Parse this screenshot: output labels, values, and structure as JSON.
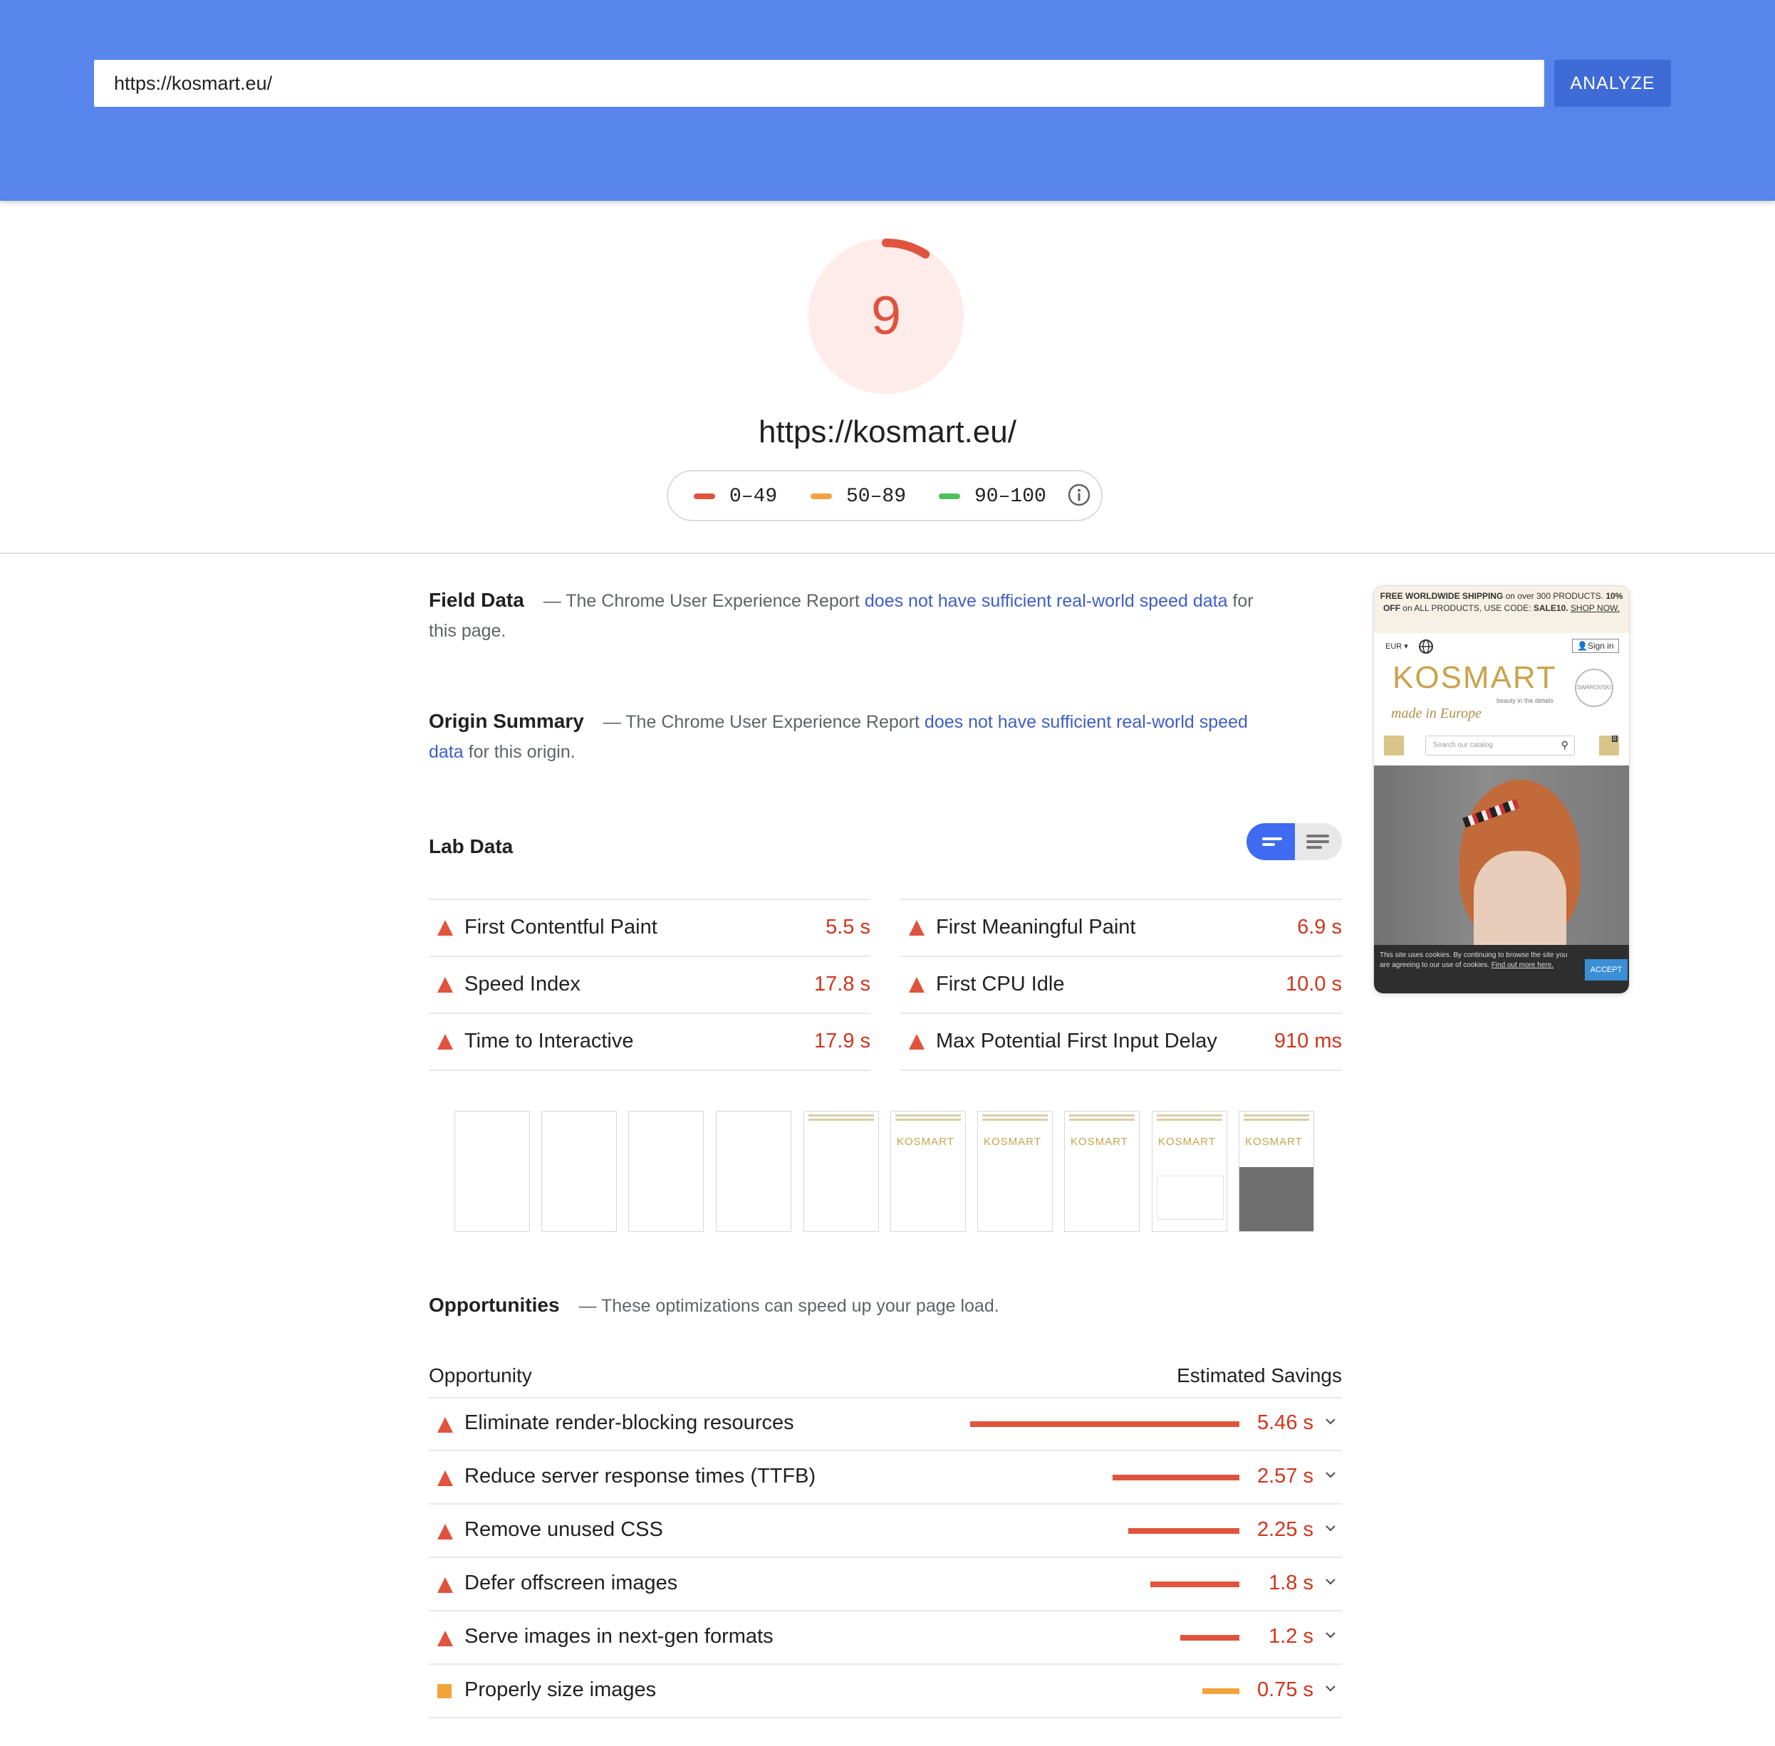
{
  "header": {
    "url_value": "https://kosmart.eu/",
    "analyze_label": "ANALYZE"
  },
  "score": {
    "value": "9",
    "fraction": 0.09,
    "color": "#e0543e",
    "bg_color": "#fdece9"
  },
  "page_url": "https://kosmart.eu/",
  "legend": {
    "ranges": [
      {
        "label": "0–49",
        "color": "#e0543e"
      },
      {
        "label": "50–89",
        "color": "#f2a33a"
      },
      {
        "label": "90–100",
        "color": "#4fc05a"
      }
    ],
    "info_icon": "info-icon"
  },
  "field_data": {
    "title": "Field Data",
    "prefix": "— The Chrome User Experience Report ",
    "link": "does not have sufficient real-world speed data",
    "suffix": " for this page."
  },
  "origin_summary": {
    "title": "Origin Summary",
    "prefix": "— The Chrome User Experience Report ",
    "link": "does not have sufficient real-world speed data",
    "suffix": " for this origin."
  },
  "lab_data": {
    "title": "Lab Data",
    "metrics_left": [
      {
        "name": "First Contentful Paint",
        "value": "5.5 s"
      },
      {
        "name": "Speed Index",
        "value": "17.8 s"
      },
      {
        "name": "Time to Interactive",
        "value": "17.9 s"
      }
    ],
    "metrics_right": [
      {
        "name": "First Meaningful Paint",
        "value": "6.9 s"
      },
      {
        "name": "First CPU Idle",
        "value": "10.0 s"
      },
      {
        "name": "Max Potential First Input Delay",
        "value": "910 ms"
      }
    ]
  },
  "thumbnail": {
    "banner_bold1": "FREE WORLDWIDE SHIPPING",
    "banner_text1": " on over 300 PRODUCTS. ",
    "banner_bold2": "10% OFF",
    "banner_text2": " on ALL PRODUCTS, USE CODE: ",
    "banner_bold3": "SALE10.",
    "banner_link": "SHOP NOW.",
    "currency": "EUR ▾",
    "sign_in": "Sign in",
    "logo": "KOSMART",
    "tagline": "beauty in the details",
    "made_in": "made in Europe",
    "badge": "SWAROVSKI",
    "search_placeholder": "Search our catalog",
    "cart_count": "0",
    "cookie_text": "This site uses cookies. By continuing to browse the site you are agreeing to our use of cookies.",
    "cookie_link": "Find out more here.",
    "accept": "ACCEPT"
  },
  "opportunities": {
    "title": "Opportunities",
    "desc": "— These optimizations can speed up your page load.",
    "col_opportunity": "Opportunity",
    "col_savings": "Estimated Savings",
    "items": [
      {
        "name": "Eliminate render-blocking resources",
        "value": "5.46 s",
        "savings": 5.46,
        "level": "fail"
      },
      {
        "name": "Reduce server response times (TTFB)",
        "value": "2.57 s",
        "savings": 2.57,
        "level": "fail"
      },
      {
        "name": "Remove unused CSS",
        "value": "2.25 s",
        "savings": 2.25,
        "level": "fail"
      },
      {
        "name": "Defer offscreen images",
        "value": "1.8 s",
        "savings": 1.8,
        "level": "fail"
      },
      {
        "name": "Serve images in next-gen formats",
        "value": "1.2 s",
        "savings": 1.2,
        "level": "fail"
      },
      {
        "name": "Properly size images",
        "value": "0.75 s",
        "savings": 0.75,
        "level": "average"
      }
    ]
  }
}
